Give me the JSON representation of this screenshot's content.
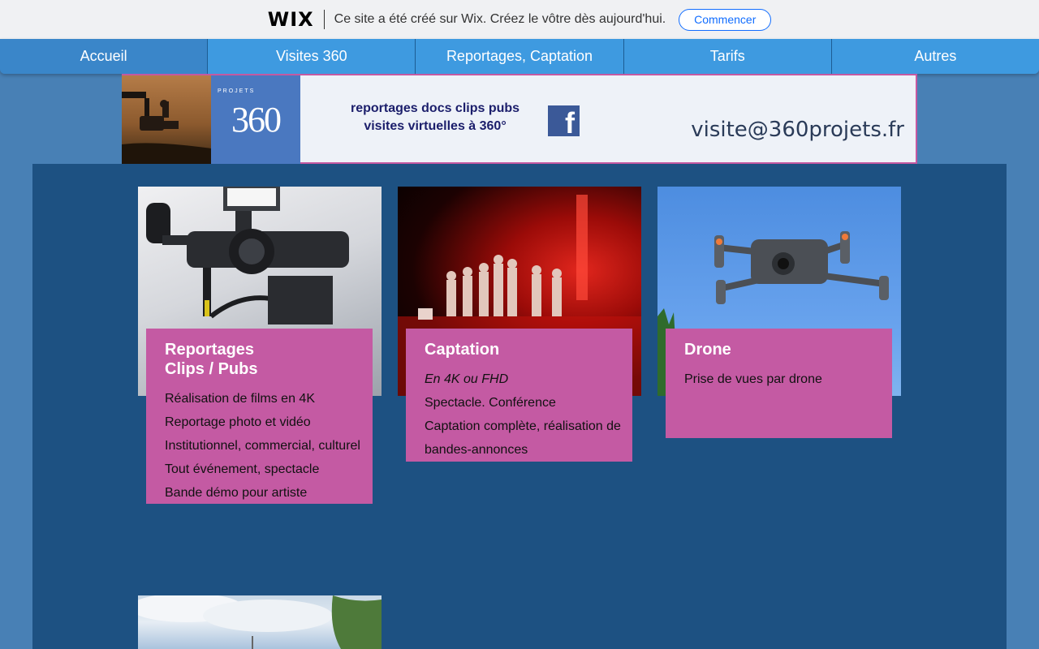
{
  "wix_banner": {
    "logo": "WIX",
    "message": "Ce site a été créé sur Wix. Créez le vôtre dès aujourd'hui.",
    "cta": "Commencer"
  },
  "nav": {
    "items": [
      "Accueil",
      "Visites 360",
      "Reportages, Captation",
      "Tarifs",
      "Autres"
    ]
  },
  "header": {
    "logo_number": "360",
    "logo_small": "PROJETS",
    "tagline_1": "reportages docs clips pubs",
    "tagline_2": "visites virtuelles à 360°",
    "facebook_glyph": "f",
    "email": "visite@360projets.fr"
  },
  "cards": [
    {
      "title_1": "Reportages",
      "title_2": "Clips / Pubs",
      "lines": [
        "Réalisation de films en 4K",
        "Reportage photo et vidéo",
        "Institutionnel, commercial, culturel",
        "Tout événement, spectacle",
        "Bande démo pour artiste"
      ]
    },
    {
      "title_1": "Captation",
      "subtitle": "En 4K ou FHD",
      "lines": [
        "Spectacle. Conférence",
        "Captation complète, réalisation de",
        "bandes-annonces"
      ]
    },
    {
      "title_1": "Drone",
      "lines": [
        "Prise de vues par drone"
      ]
    }
  ],
  "colors": {
    "background": "#4880b5",
    "panel": "#1d5182",
    "nav": "#3e9ae0",
    "card": "#c45aa3",
    "facebook": "#3b5998"
  }
}
